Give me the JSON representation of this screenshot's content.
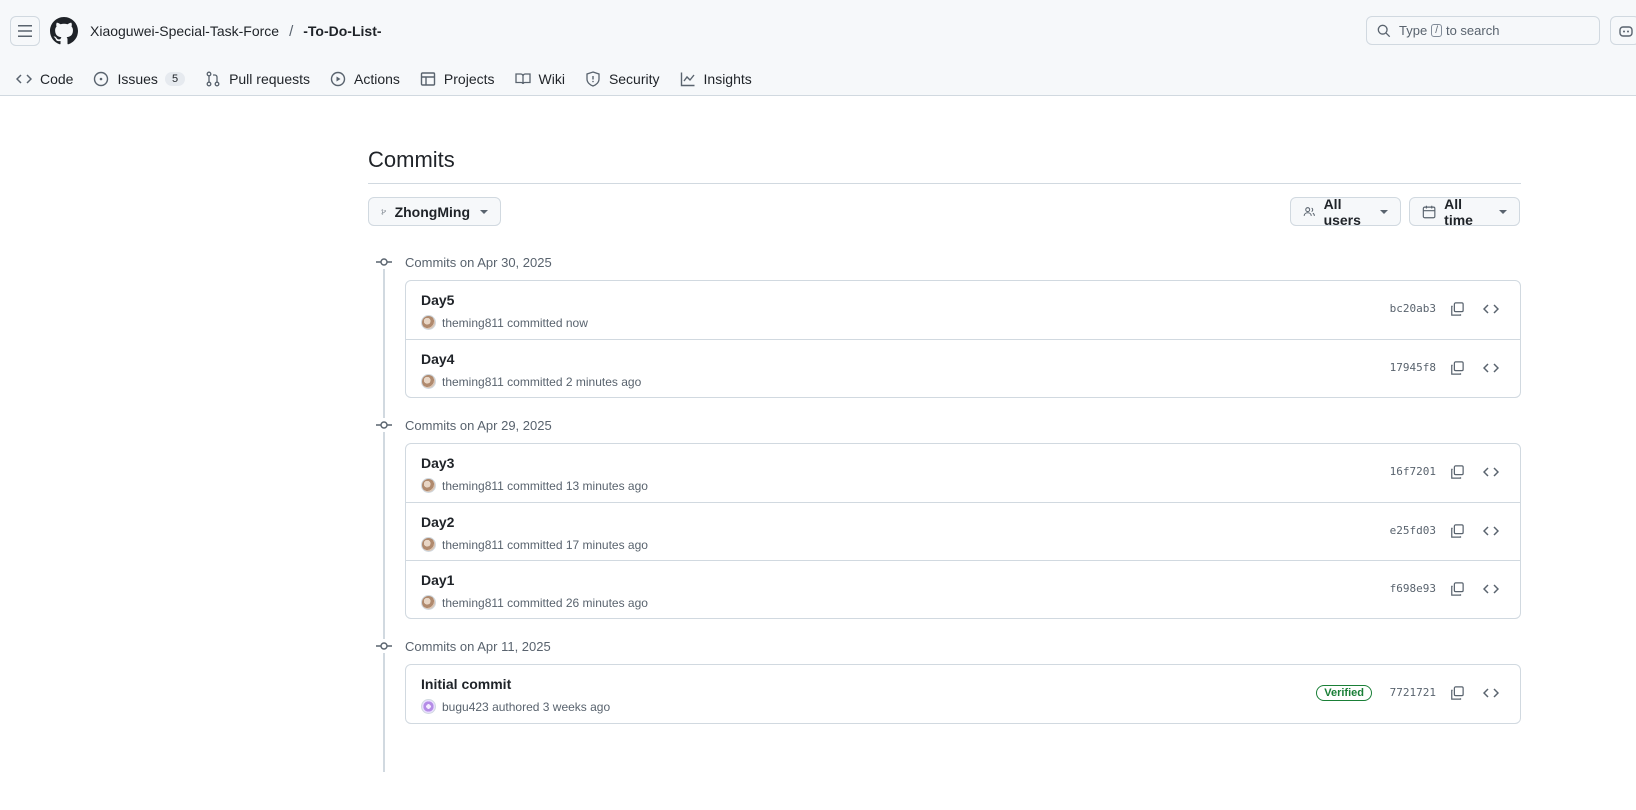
{
  "header": {
    "owner": "Xiaoguwei-Special-Task-Force",
    "separator": "/",
    "repo": "-To-Do-List-",
    "search": {
      "prefix": "Type",
      "key": "/",
      "suffix": "to search"
    }
  },
  "nav": {
    "code": "Code",
    "issues": "Issues",
    "issues_count": "5",
    "pulls": "Pull requests",
    "actions": "Actions",
    "projects": "Projects",
    "wiki": "Wiki",
    "security": "Security",
    "insights": "Insights"
  },
  "page": {
    "title": "Commits",
    "branch": "ZhongMing",
    "users_filter": "All users",
    "time_filter": "All time"
  },
  "groups": [
    {
      "heading": "Commits on Apr 30, 2025",
      "commits": [
        {
          "title": "Day5",
          "author": "theming811",
          "action": "committed",
          "when": "now",
          "sha": "bc20ab3"
        },
        {
          "title": "Day4",
          "author": "theming811",
          "action": "committed",
          "when": "2 minutes ago",
          "sha": "17945f8"
        }
      ]
    },
    {
      "heading": "Commits on Apr 29, 2025",
      "commits": [
        {
          "title": "Day3",
          "author": "theming811",
          "action": "committed",
          "when": "13 minutes ago",
          "sha": "16f7201"
        },
        {
          "title": "Day2",
          "author": "theming811",
          "action": "committed",
          "when": "17 minutes ago",
          "sha": "e25fd03"
        },
        {
          "title": "Day1",
          "author": "theming811",
          "action": "committed",
          "when": "26 minutes ago",
          "sha": "f698e93"
        }
      ]
    },
    {
      "heading": "Commits on Apr 11, 2025",
      "commits": [
        {
          "title": "Initial commit",
          "author": "bugu423",
          "action": "authored",
          "when": "3 weeks ago",
          "sha": "7721721",
          "badge": "Verified"
        }
      ]
    }
  ]
}
